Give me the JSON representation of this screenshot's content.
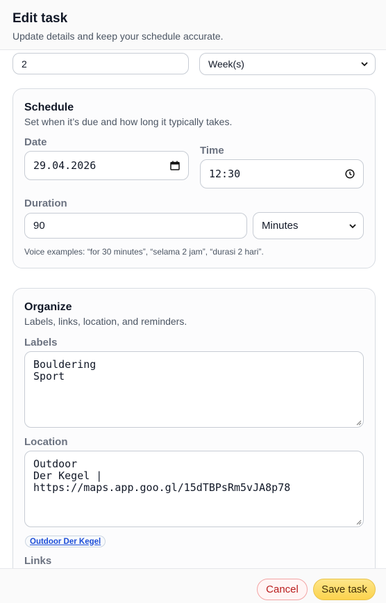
{
  "header": {
    "title": "Edit task",
    "subtitle": "Update details and keep your schedule accurate."
  },
  "repeat": {
    "interval_value": "2",
    "unit_selected": "Week(s)"
  },
  "schedule": {
    "title": "Schedule",
    "subtitle": "Set when it’s due and how long it typically takes.",
    "date_label": "Date",
    "date_value": "29.04.2026",
    "time_label": "Time",
    "time_value": "12:30",
    "duration_label": "Duration",
    "duration_value": "90",
    "duration_unit_selected": "Minutes",
    "voice_hint": "Voice examples: “for 30 minutes”, “selama 2 jam”, “durasi 2 hari”."
  },
  "organize": {
    "title": "Organize",
    "subtitle": "Labels, links, location, and reminders.",
    "labels_label": "Labels",
    "labels_value": "Bouldering\nSport",
    "location_label": "Location",
    "location_value": "Outdoor\nDer Kegel |\nhttps://maps.app.goo.gl/15dTBPsRm5vJA8p78",
    "location_chip": "Outdoor Der Kegel",
    "links_label": "Links"
  },
  "footer": {
    "cancel_label": "Cancel",
    "save_label": "Save task"
  },
  "icons": {
    "select_chevron": "chevron-down-icon",
    "calendar": "calendar-icon",
    "clock": "clock-icon",
    "resize": "resize-grip-icon"
  }
}
